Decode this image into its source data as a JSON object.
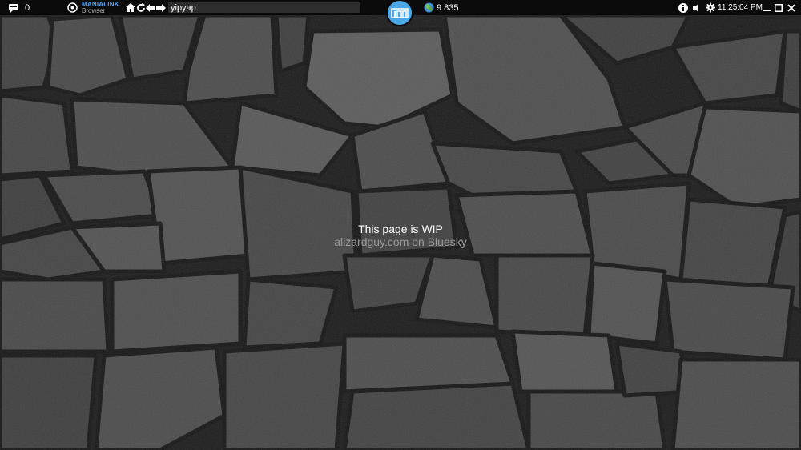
{
  "topbar": {
    "chat_count": "0",
    "brand_line1": "MANIALINK",
    "brand_line2": "Browser",
    "address": "yipyap",
    "planets": "9 835",
    "clock": "11:25:04 PM"
  },
  "icons": {
    "chat": "chat-bubble-icon",
    "logo": "manialink-logo-icon",
    "home": "home-icon",
    "refresh": "refresh-icon",
    "back": "arrow-left-icon",
    "forward": "arrow-right-icon",
    "badge": "maniaplanet-home-icon",
    "planets": "planets-coin-icon",
    "info": "info-icon",
    "sound": "speaker-icon",
    "settings": "gear-icon",
    "minimize": "minimize-icon",
    "maximize": "maximize-icon",
    "close": "close-icon"
  },
  "colors": {
    "accent": "#4aa9e6",
    "topbar": "#0b0b0b"
  },
  "page": {
    "line1": "This page is WIP",
    "line2": "alizardguy.com on Bluesky"
  }
}
